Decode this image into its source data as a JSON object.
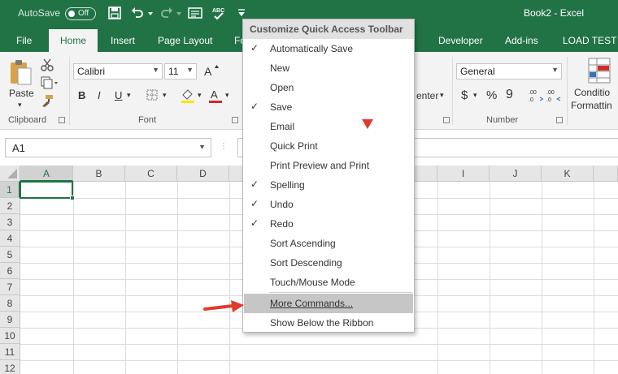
{
  "titlebar": {
    "autosave_label": "AutoSave",
    "autosave_state": "Off",
    "doc_title": "Book2  -  Excel"
  },
  "tabs": [
    "File",
    "Home",
    "Insert",
    "Page Layout",
    "Fo",
    "Developer",
    "Add-ins",
    "LOAD TEST"
  ],
  "ribbon": {
    "clipboard": {
      "paste": "Paste",
      "label": "Clipboard"
    },
    "font": {
      "name": "Calibri",
      "size": "11",
      "label": "Font",
      "bold": "B",
      "italic": "I",
      "underline": "U"
    },
    "alignment": {
      "partial": "enter"
    },
    "number": {
      "format": "General",
      "label": "Number",
      "currency": "$",
      "percent": "%",
      "comma": "9"
    },
    "styles": {
      "conditional_1": "Conditio",
      "conditional_2": "Formattin"
    }
  },
  "formula_bar": {
    "name_box": "A1",
    "dots": "⋮"
  },
  "grid": {
    "columns": [
      "A",
      "B",
      "C",
      "D",
      "I",
      "J",
      "K"
    ],
    "rows": [
      "1",
      "2",
      "3",
      "4",
      "5",
      "6",
      "7",
      "8",
      "9",
      "10",
      "11",
      "12"
    ],
    "active_cell": "A1"
  },
  "menu": {
    "title": "Customize Quick Access Toolbar",
    "items": [
      {
        "label": "Automatically Save",
        "checked": true
      },
      {
        "label": "New",
        "checked": false
      },
      {
        "label": "Open",
        "checked": false
      },
      {
        "label": "Save",
        "checked": true
      },
      {
        "label": "Email",
        "checked": false
      },
      {
        "label": "Quick Print",
        "checked": false
      },
      {
        "label": "Print Preview and Print",
        "checked": false
      },
      {
        "label": "Spelling",
        "checked": true
      },
      {
        "label": "Undo",
        "checked": true
      },
      {
        "label": "Redo",
        "checked": true
      },
      {
        "label": "Sort Ascending",
        "checked": false
      },
      {
        "label": "Sort Descending",
        "checked": false
      },
      {
        "label": "Touch/Mouse Mode",
        "checked": false
      }
    ],
    "more_commands": "More Commands...",
    "show_below": "Show Below the Ribbon",
    "check_glyph": "✓"
  },
  "colors": {
    "brand": "#217346",
    "annotation": "#e03a2f",
    "highlight": "#c6c6c6"
  },
  "icons": [
    "save-icon",
    "undo-icon",
    "redo-icon",
    "form-icon",
    "spelling-icon",
    "qat-dropdown-icon"
  ]
}
